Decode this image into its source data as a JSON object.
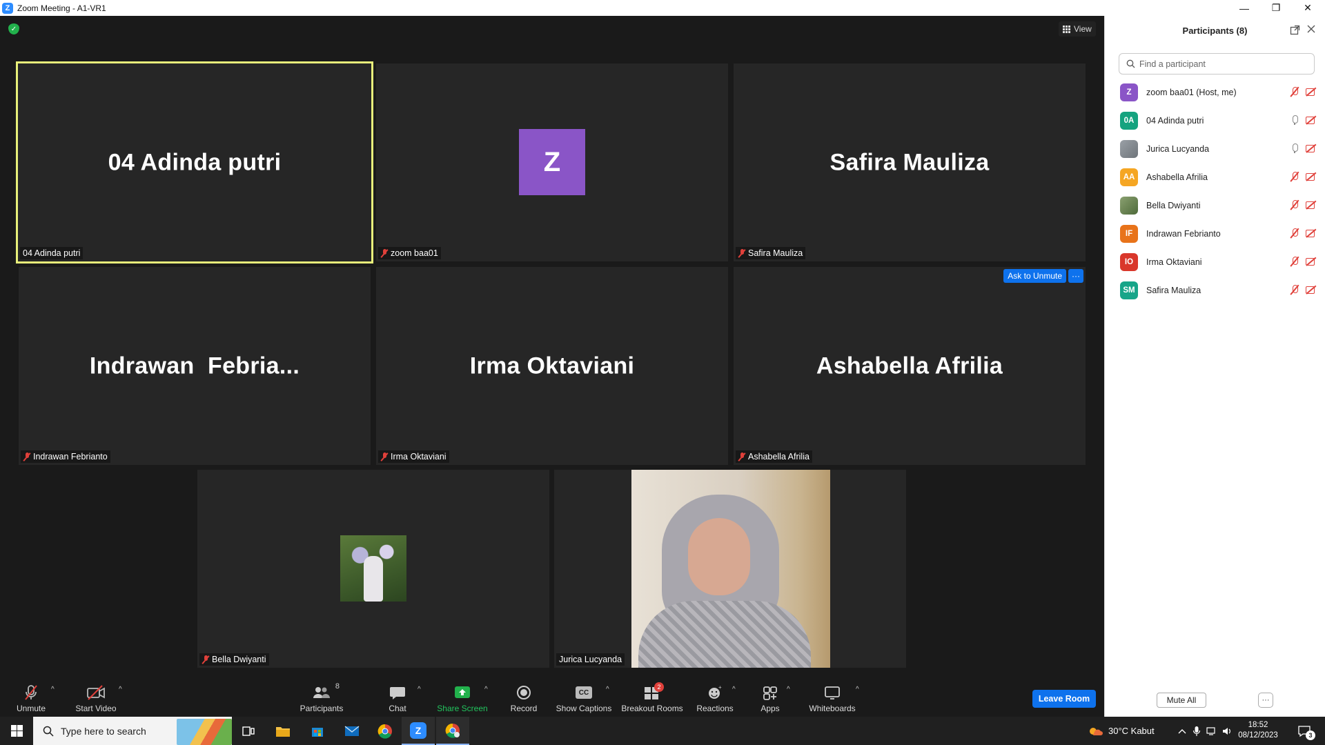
{
  "window": {
    "title": "Zoom Meeting - A1-VR1",
    "logo_letter": "Z",
    "controls": [
      "—",
      "❐",
      "✕"
    ]
  },
  "meeting": {
    "view_label": "View",
    "tiles": [
      {
        "big_name": "04 Adinda putri",
        "label": "04 Adinda putri",
        "muted": false,
        "active": true
      },
      {
        "avatar_letter": "Z",
        "label": "zoom baa01",
        "muted": true
      },
      {
        "big_name": "Safira Mauliza",
        "label": "Safira Mauliza",
        "muted": true
      },
      {
        "big_name": "Indrawan  Febria...",
        "label": "Indrawan Febrianto",
        "muted": true
      },
      {
        "big_name": "Irma Oktaviani",
        "label": "Irma Oktaviani",
        "muted": true
      },
      {
        "big_name": "Ashabella Afrilia",
        "label": "Ashabella Afrilia",
        "muted": true,
        "ask_to_unmute": "Ask to Unmute",
        "more": "···"
      },
      {
        "label": "Bella Dwiyanti",
        "muted": true
      },
      {
        "label": "Jurica Lucyanda",
        "muted": false
      }
    ]
  },
  "toolbar": {
    "unmute": "Unmute",
    "start_video": "Start Video",
    "participants": "Participants",
    "participants_count": "8",
    "chat": "Chat",
    "share_screen": "Share Screen",
    "record": "Record",
    "show_captions": "Show Captions",
    "captions_icon": "CC",
    "breakout_rooms": "Breakout Rooms",
    "breakout_badge": "2",
    "reactions": "Reactions",
    "apps": "Apps",
    "whiteboards": "Whiteboards",
    "leave_room": "Leave Room",
    "caret": "^"
  },
  "participants_panel": {
    "title": "Participants (8)",
    "search_placeholder": "Find a participant",
    "mute_all": "Mute All",
    "more": "···",
    "list": [
      {
        "initials": "Z",
        "name": "zoom baa01 (Host, me)",
        "color": "#8a55c7",
        "mic": "muted",
        "cam": "off"
      },
      {
        "initials": "0A",
        "name": "04 Adinda putri",
        "color": "#15a37f",
        "mic": "on",
        "cam": "off"
      },
      {
        "initials": "",
        "name": "Jurica Lucyanda",
        "color": "photo1",
        "mic": "on",
        "cam": "off"
      },
      {
        "initials": "AA",
        "name": "Ashabella Afrilia",
        "color": "#f5a623",
        "mic": "muted",
        "cam": "off"
      },
      {
        "initials": "",
        "name": "Bella Dwiyanti",
        "color": "photo2",
        "mic": "muted",
        "cam": "off"
      },
      {
        "initials": "IF",
        "name": "Indrawan Febrianto",
        "color": "#e8731a",
        "mic": "muted",
        "cam": "off"
      },
      {
        "initials": "IO",
        "name": "Irma Oktaviani",
        "color": "#d9372b",
        "mic": "muted",
        "cam": "off"
      },
      {
        "initials": "SM",
        "name": "Safira Mauliza",
        "color": "#17a589",
        "mic": "muted",
        "cam": "off"
      }
    ]
  },
  "taskbar": {
    "search_placeholder": "Type here to search",
    "weather": "30°C  Kabut",
    "time": "18:52",
    "date": "08/12/2023",
    "notification_count": "3"
  }
}
